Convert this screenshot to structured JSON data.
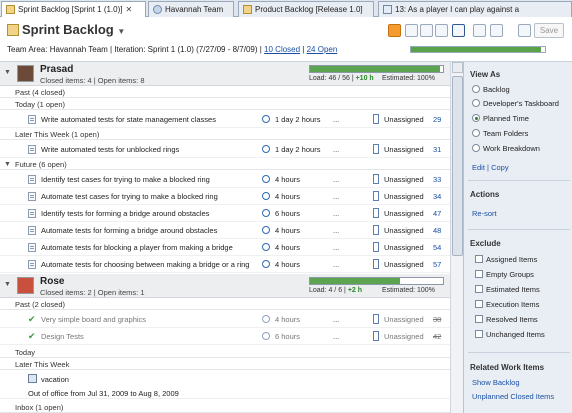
{
  "tabs": [
    {
      "label": "Sprint Backlog [Sprint 1 (1.0)]",
      "active": true
    },
    {
      "label": "Havannah Team",
      "active": false
    },
    {
      "label": "Product Backlog [Release 1.0]",
      "active": false
    },
    {
      "label": "13: As a player I can play against a",
      "active": false
    }
  ],
  "header": {
    "title": "Sprint Backlog",
    "team_area_label": "Team Area: Havannah Team | Iteration: Sprint 1 (1.0) (7/27/09 - 8/7/09) |",
    "closed_link": "10 Closed",
    "open_link": "24 Open",
    "save_label": "Save",
    "progress": 0.97
  },
  "people": [
    {
      "name": "Prasad",
      "stats": "Closed items: 4 | Open items: 8",
      "load": "Load: 46 / 56 |",
      "load_extra": "+10 h",
      "estimated": "Estimated: 100%",
      "progress": 0.98
    },
    {
      "name": "Rose",
      "stats": "Closed items: 2 | Open items: 1",
      "load": "Load: 4 / 6 |",
      "load_extra": "+2 h",
      "estimated": "Estimated: 100%",
      "progress": 0.68
    }
  ],
  "groups": {
    "p_past": "Past (4 closed)",
    "p_today": "Today (1 open)",
    "p_later": "Later This Week (1 open)",
    "p_future": "Future (6 open)",
    "r_past": "Past (2 closed)",
    "r_today": "Today",
    "r_later": "Later This Week",
    "r_inbox": "Inbox (1 open)"
  },
  "rows": [
    {
      "summary": "Write automated tests for state management classes",
      "duration": "1 day 2 hours",
      "dash": "...",
      "owner": "Unassigned",
      "id": "29"
    },
    {
      "summary": "Write automated tests for unblocked rings",
      "duration": "1 day 2 hours",
      "dash": "...",
      "owner": "Unassigned",
      "id": "31"
    },
    {
      "summary": "Identify test cases for trying to make a blocked ring",
      "duration": "4 hours",
      "dash": "...",
      "owner": "Unassigned",
      "id": "33"
    },
    {
      "summary": "Automate test cases for trying to make a blocked ring",
      "duration": "4 hours",
      "dash": "...",
      "owner": "Unassigned",
      "id": "34"
    },
    {
      "summary": "Identify tests for forming a bridge around obstacles",
      "duration": "6 hours",
      "dash": "...",
      "owner": "Unassigned",
      "id": "47"
    },
    {
      "summary": "Automate tests for forming a bridge around obstacles",
      "duration": "4 hours",
      "dash": "...",
      "owner": "Unassigned",
      "id": "48"
    },
    {
      "summary": "Automate tests for blocking a player from making a bridge",
      "duration": "4 hours",
      "dash": "...",
      "owner": "Unassigned",
      "id": "54"
    },
    {
      "summary": "Automate tests for choosing between making a bridge or a ring",
      "duration": "4 hours",
      "dash": "...",
      "owner": "Unassigned",
      "id": "57"
    }
  ],
  "rose_rows": [
    {
      "summary": "Very simple board and graphics",
      "duration": "4 hours",
      "dash": "...",
      "owner": "Unassigned",
      "id": "38"
    },
    {
      "summary": "Design Tests",
      "duration": "6 hours",
      "dash": "...",
      "owner": "Unassigned",
      "id": "42"
    }
  ],
  "vacation": {
    "title": "vacation",
    "range": "Out of office from Jul 31, 2009 to Aug 8, 2009"
  },
  "sidebar": {
    "view_as": "View As",
    "views": [
      "Backlog",
      "Developer's Taskboard",
      "Planned Time",
      "Team Folders",
      "Work Breakdown"
    ],
    "selected_view": "Planned Time",
    "edit": "Edit",
    "copy": "Copy",
    "actions": "Actions",
    "resort": "Re-sort",
    "exclude": "Exclude",
    "excludes": [
      "Assigned Items",
      "Empty Groups",
      "Estimated Items",
      "Execution Items",
      "Resolved Items",
      "Unchanged Items"
    ],
    "related": "Related Work Items",
    "show_backlog": "Show Backlog",
    "unplanned": "Unplanned Closed Items"
  }
}
